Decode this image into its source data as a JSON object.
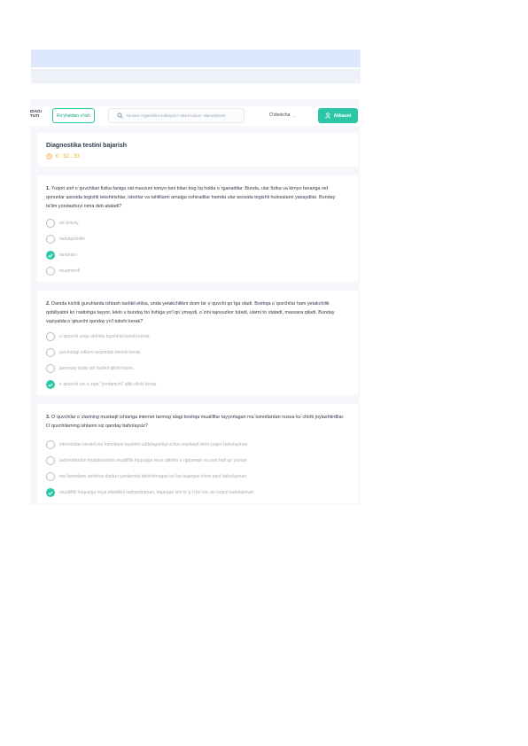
{
  "header": {
    "logo_line1": "IDAGI",
    "logo_line2": "TUTI",
    "register_label": "Ro'yhatdan o'tish",
    "search_placeholder": "Nimani o'rganishni xohlaysiz? Misol uchun: Menedjment",
    "language": "O'zbekcha",
    "account_label": "Akkaunt"
  },
  "test": {
    "title": "Diagnostika testini bajarish",
    "timer": "0 : 32 : 33"
  },
  "questions": [
    {
      "number": "1.",
      "text": "Yuqori sinf o`quvchilari fizika faniga oid mavzuni kimyo fani bilan bog`liq holda o`rganadilar. Bunda, ular fizika va kimyo fanariga oid qonunlar asosida tegishli tekshirishlar, isbotlar va tahlillarni amalga oshiradilar hamda ular asosida tegishli hulosalarni yasaydilar. Bunday ta'lim yondashuvi nima deb ataladi?",
      "options": [
        {
          "label": "an`anaviy",
          "checked": false
        },
        {
          "label": "tadqiqotchilik",
          "checked": false
        },
        {
          "label": "fanlararo",
          "checked": true
        },
        {
          "label": "muammoli",
          "checked": false
        }
      ]
    },
    {
      "number": "2.",
      "text": "Darsda kichik guruhlarda ishlash tashkil etilsa, unda yetakchilikni doim bir o`quvchi qo`lga oladi. Boshqa o`quvchilar ham yetakchilik qobiliyatini ko`rsatishga tayyor, lekin u bunday bo`lishiga yo'l qo`ymaydi, o`zini tajovuzkor tutadi, ularni to`xtatadi, masxara qiladi. Bunday vaziyatda o`qituvchi qanday yo'l tutishi kerak?",
      "options": [
        {
          "label": "o`qituvchi unga alohida topshiriq berishi kerak.",
          "checked": false
        },
        {
          "label": "guruhdagi rollarni taqsimlab berishi kerak.",
          "checked": false
        },
        {
          "label": "jamoaviy ijodiy ish tashkil qilishi lozim.",
          "checked": false
        },
        {
          "label": "o`qituvchi uni o`ziga \"yordamchi\" qilib olishi kerak.",
          "checked": true
        }
      ]
    },
    {
      "number": "3.",
      "text": "O`quvchilar o`zlarining mustaqil ishlariga internet tarmog`idagi boshqa mualliflar tayyorlagan ma`lumotlardan nusxa ko`chirib joylashtirdilar. O`quvchilarning ishlarini siz qanday baholaysiz?",
      "options": [
        {
          "label": "internetdan kerakli ma`lumotlarni topishni uddalaganligi uchun mustaqil ishni yuqori baholayman",
          "checked": false
        },
        {
          "label": "axborotlardan foydalanishda mualliflik huquqiga rioya qilishni o`rgataman va past ball qo`yaman",
          "checked": false
        },
        {
          "label": "ma`lumotlarni antivirus dasturi yordamida tekshirmagan bo`lsa bajargan ishini past baholayman",
          "checked": false
        },
        {
          "label": "mualliflik huquqiga rioya etishlikni tushuntiraman, bajargan ishi to`g`ri bo`lsa uni yuqori baholayman",
          "checked": true
        }
      ]
    }
  ],
  "colors": {
    "accent": "#2cc7a7",
    "timer": "#f5a623",
    "top_bar": "#dce8fb"
  }
}
